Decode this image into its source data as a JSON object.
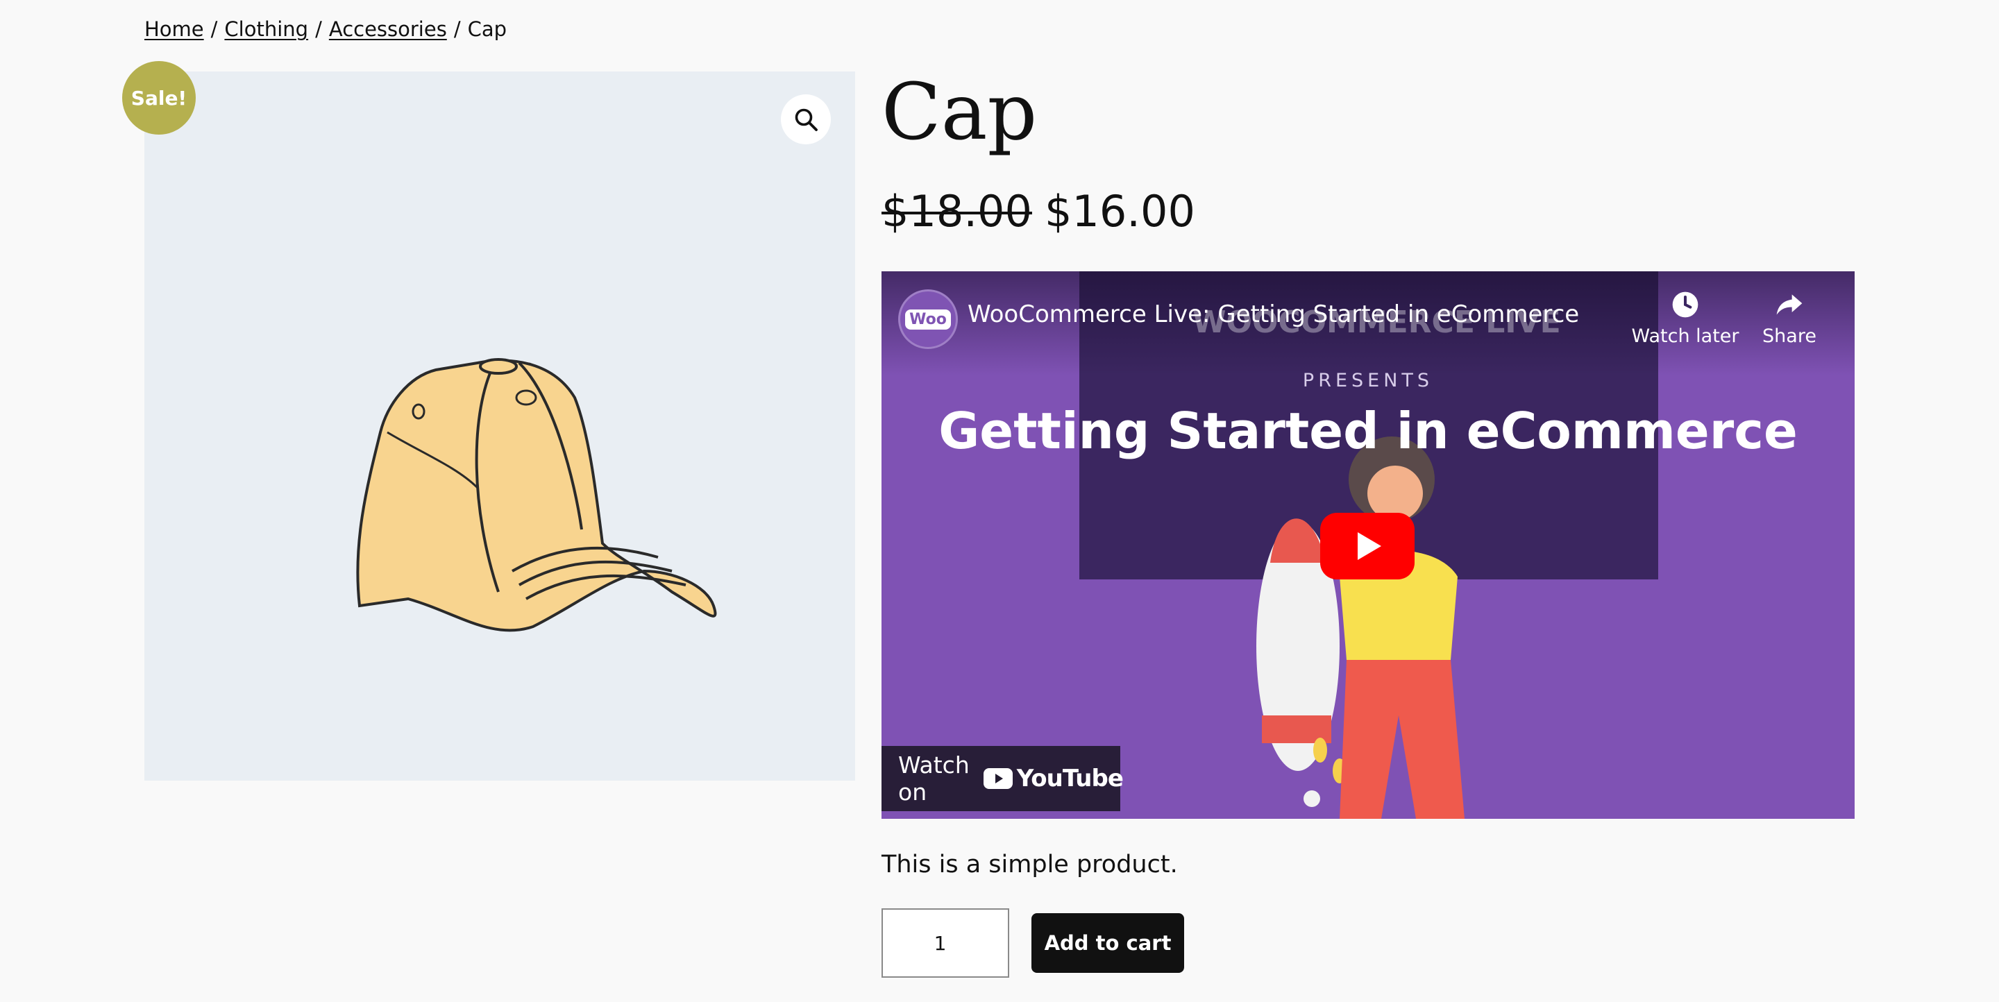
{
  "breadcrumb": {
    "home": "Home",
    "clothing": "Clothing",
    "accessories": "Accessories",
    "current": "Cap",
    "separator": "/"
  },
  "gallery": {
    "sale_badge": "Sale!",
    "zoom_icon": "magnifier-icon",
    "image_alt": "Cap"
  },
  "product": {
    "title": "Cap",
    "regular_price": "$18.00",
    "sale_price": "$16.00",
    "description": "This is a simple product."
  },
  "video": {
    "title": "WooCommerce Live: Getting Started in eCommerce",
    "channel_badge": "Woo",
    "watch_later_label": "Watch later",
    "share_label": "Share",
    "brand_text": "WOOCOMMERCE LIVE",
    "presents_text": "PRESENTS",
    "headline": "Getting Started in eCommerce",
    "watch_on_label": "Watch on",
    "youtube_label": "YouTube"
  },
  "cart": {
    "quantity": "1",
    "add_to_cart_label": "Add to cart"
  },
  "colors": {
    "sale_badge": "#b5b04f",
    "gallery_bg": "#e9eef3",
    "video_bg": "#7f52b4",
    "button_bg": "#111111",
    "youtube_red": "#ff0000"
  }
}
